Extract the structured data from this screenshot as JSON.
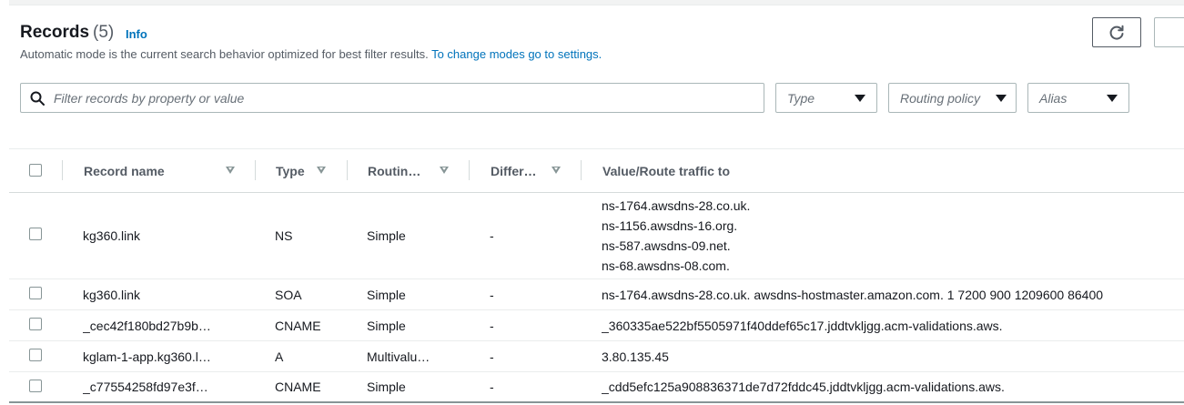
{
  "header": {
    "title": "Records",
    "count": "(5)",
    "info": "Info",
    "description": "Automatic mode is the current search behavior optimized for best filter results.",
    "settings_link": "To change modes go to settings."
  },
  "search": {
    "placeholder": "Filter records by property or value"
  },
  "filters": {
    "type": "Type",
    "routing": "Routing policy",
    "alias": "Alias"
  },
  "columns": {
    "record_name": "Record name",
    "type": "Type",
    "routing": "Routin…",
    "differ": "Differ…",
    "value": "Value/Route traffic to"
  },
  "rows": [
    {
      "name": "kg360.link",
      "type": "NS",
      "routing": "Simple",
      "differ": "-",
      "values": [
        "ns-1764.awsdns-28.co.uk.",
        "ns-1156.awsdns-16.org.",
        "ns-587.awsdns-09.net.",
        "ns-68.awsdns-08.com."
      ]
    },
    {
      "name": "kg360.link",
      "type": "SOA",
      "routing": "Simple",
      "differ": "-",
      "values": [
        "ns-1764.awsdns-28.co.uk. awsdns-hostmaster.amazon.com. 1 7200 900 1209600 86400"
      ]
    },
    {
      "name": "_cec42f180bd27b9b…",
      "type": "CNAME",
      "routing": "Simple",
      "differ": "-",
      "values": [
        "_360335ae522bf5505971f40ddef65c17.jddtvkljgg.acm-validations.aws."
      ]
    },
    {
      "name": "kglam-1-app.kg360.l…",
      "type": "A",
      "routing": "Multivalu…",
      "differ": "-",
      "values": [
        "3.80.135.45"
      ]
    },
    {
      "name": "_c77554258fd97e3f…",
      "type": "CNAME",
      "routing": "Simple",
      "differ": "-",
      "values": [
        "_cdd5efc125a908836371de7d72fddc45.jddtvkljgg.acm-validations.aws."
      ]
    }
  ]
}
